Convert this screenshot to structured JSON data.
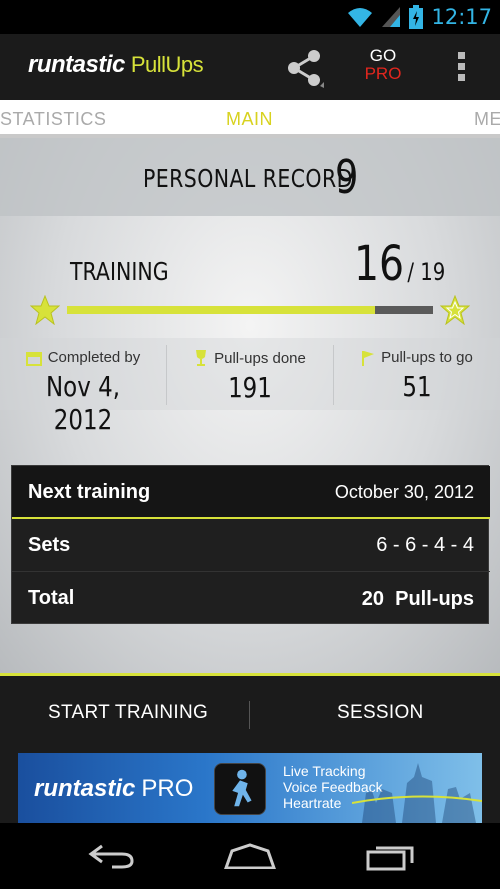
{
  "status_bar": {
    "time": "12:17",
    "icons": [
      "wifi-icon",
      "signal-icon",
      "battery-icon"
    ]
  },
  "action_bar": {
    "brand": "runtastic",
    "brand_sub": "PullUps",
    "share_icon": "share-icon",
    "go_label": "GO",
    "pro_label": "PRO",
    "overflow_icon": "overflow-menu-icon"
  },
  "tabs": [
    {
      "label": "STATISTICS",
      "active": false
    },
    {
      "label": "MAIN",
      "active": true
    },
    {
      "label": "ME",
      "active": false
    }
  ],
  "personal_record": {
    "label": "PERSONAL RECORD",
    "value": "9"
  },
  "training": {
    "label": "TRAINING",
    "done": "16",
    "total": "/ 19",
    "progress_fraction": 0.842
  },
  "stats": [
    {
      "icon": "calendar-icon",
      "label": "Completed by",
      "value": "Nov 4, 2012"
    },
    {
      "icon": "trophy-icon",
      "label": "Pull-ups done",
      "value": "191"
    },
    {
      "icon": "flag-icon",
      "label": "Pull-ups to go",
      "value": "51"
    }
  ],
  "info": {
    "next_training": {
      "label": "Next training",
      "value": "October 30, 2012"
    },
    "sets": {
      "label": "Sets",
      "value": "6 - 6 - 4 - 4"
    },
    "total": {
      "label": "Total",
      "value": "20  Pull-ups"
    }
  },
  "bottom_actions": {
    "start": "START TRAINING",
    "session": "SESSION"
  },
  "ad": {
    "brand": "runtastic",
    "brand_pro": "PRO",
    "features": [
      "Live Tracking",
      "Voice Feedback",
      "Heartrate"
    ]
  },
  "colors": {
    "accent": "#d7e23a",
    "pro_red": "#e2261e",
    "status_blue": "#33b5e5"
  },
  "nav_icons": [
    "back-icon",
    "home-icon",
    "recent-apps-icon"
  ]
}
